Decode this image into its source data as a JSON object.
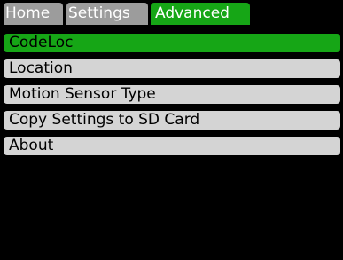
{
  "colors": {
    "background": "#000000",
    "tab_inactive": "#9c9c9c",
    "tab_active": "#16a616",
    "item_background": "#d4d4d4",
    "item_selected": "#16a616"
  },
  "tabs": [
    {
      "label": "Home",
      "active": false
    },
    {
      "label": "Settings",
      "active": false
    },
    {
      "label": "Advanced",
      "active": true
    }
  ],
  "menu": {
    "items": [
      {
        "label": "CodeLoc",
        "selected": true
      },
      {
        "label": "Location",
        "selected": false
      },
      {
        "label": "Motion Sensor Type",
        "selected": false
      },
      {
        "label": "Copy Settings to SD Card",
        "selected": false
      },
      {
        "label": "About",
        "selected": false
      }
    ]
  }
}
